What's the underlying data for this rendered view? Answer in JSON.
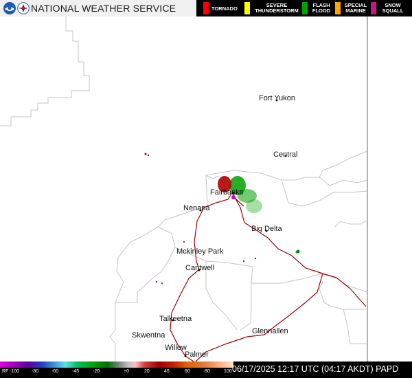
{
  "header": {
    "title": "NATIONAL WEATHER SERVICE",
    "logos": [
      "noaa-logo",
      "nws-logo"
    ]
  },
  "legend": [
    {
      "label": "TORNADO",
      "color": "#ff0000"
    },
    {
      "label": "SEVERE THUNDERSTORM",
      "color": "#ffff00"
    },
    {
      "label": "FLASH FLOOD",
      "color": "#00a000"
    },
    {
      "label": "SPECIAL MARINE",
      "color": "#ffa500"
    },
    {
      "label": "SNOW SQUALL",
      "color": "#c71585"
    }
  ],
  "towns": [
    "Fort Yukon",
    "Central",
    "Fairbanks",
    "Nenana",
    "Big Delta",
    "Mckinley Park",
    "Cantwell",
    "Talkeetna",
    "Skwentna",
    "Glennallen",
    "Willow",
    "Palmer"
  ],
  "scale": {
    "prefix": "RF",
    "labels": [
      "-100",
      "-80",
      "-60",
      "-45",
      "-20",
      "+0",
      "20",
      "45",
      "60",
      "80",
      "100"
    ]
  },
  "timestamp": "06/17/2025 12:17 UTC (04:17 AKDT) PAPD",
  "colors": {
    "header_bg": "#f0f0f0",
    "legend_bg": "#000000",
    "border_lines": "#c0c0c0",
    "roads": "#a00000",
    "radar_red": "#b00000",
    "radar_green": "#00a000",
    "radar_magenta": "#d000d0"
  }
}
